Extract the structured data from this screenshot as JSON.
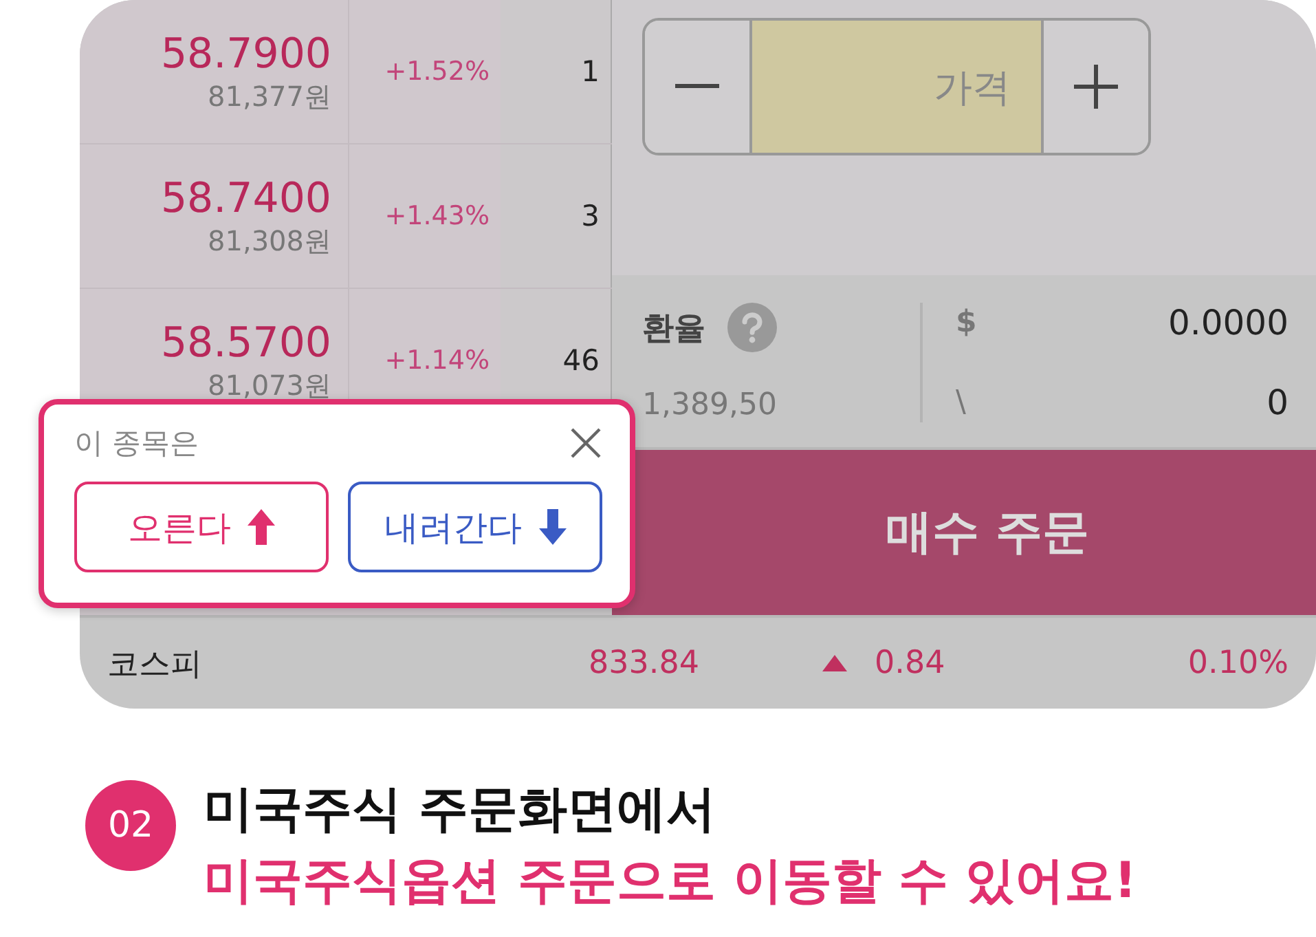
{
  "orderbook": [
    {
      "price": "58.7900",
      "krw": "81,377원",
      "change": "+1.52%",
      "quantity": "1"
    },
    {
      "price": "58.7400",
      "krw": "81,308원",
      "change": "+1.43%",
      "quantity": "3"
    },
    {
      "price": "58.5700",
      "krw": "81,073원",
      "change": "+1.14%",
      "quantity": "46"
    }
  ],
  "price_stepper": {
    "placeholder": "가격"
  },
  "exchange": {
    "label": "환율",
    "rate": "1,389,50",
    "usd_symbol": "$",
    "usd_amount": "0.0000",
    "krw_symbol": "\\",
    "krw_amount": "0"
  },
  "buy_button": "매수 주문",
  "index": {
    "name": "코스피",
    "value": "833.84",
    "rising": true,
    "change": "0.84",
    "percent": "0.10%"
  },
  "popup": {
    "title": "이 종목은",
    "buttons": [
      {
        "label": "오른다",
        "kind": "up"
      },
      {
        "label": "내려간다",
        "kind": "down"
      }
    ]
  },
  "caption": {
    "step": "02",
    "line1": "미국주식 주문화면에서",
    "line2": "미국주식옵션 주문으로 이동할 수 있어요!"
  }
}
